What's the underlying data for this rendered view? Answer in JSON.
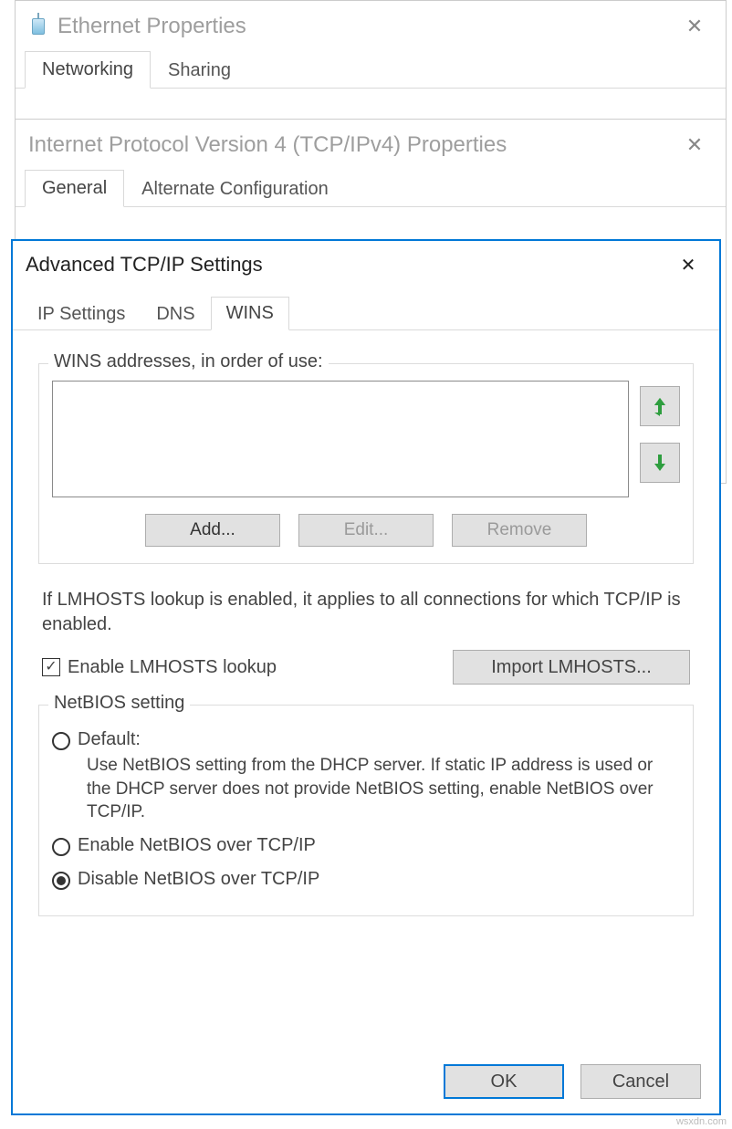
{
  "win1": {
    "title": "Ethernet Properties",
    "tabs": {
      "networking": "Networking",
      "sharing": "Sharing"
    }
  },
  "win2": {
    "title": "Internet Protocol Version 4 (TCP/IPv4) Properties",
    "tabs": {
      "general": "General",
      "alternate": "Alternate Configuration"
    }
  },
  "win3": {
    "title": "Advanced TCP/IP Settings",
    "tabs": {
      "ip": "IP Settings",
      "dns": "DNS",
      "wins": "WINS"
    },
    "wins": {
      "legend": "WINS addresses, in order of use:",
      "add": "Add...",
      "edit": "Edit...",
      "remove": "Remove"
    },
    "note": "If LMHOSTS lookup is enabled, it applies to all connections for which TCP/IP is enabled.",
    "lmhosts": {
      "checkbox": "Enable LMHOSTS lookup",
      "import": "Import LMHOSTS..."
    },
    "netbios": {
      "legend": "NetBIOS setting",
      "default_label": "Default:",
      "default_desc": "Use NetBIOS setting from the DHCP server. If static IP address is used or the DHCP server does not provide NetBIOS setting, enable NetBIOS over TCP/IP.",
      "enable": "Enable NetBIOS over TCP/IP",
      "disable": "Disable NetBIOS over TCP/IP"
    },
    "buttons": {
      "ok": "OK",
      "cancel": "Cancel"
    }
  },
  "watermark": "wsxdn.com"
}
